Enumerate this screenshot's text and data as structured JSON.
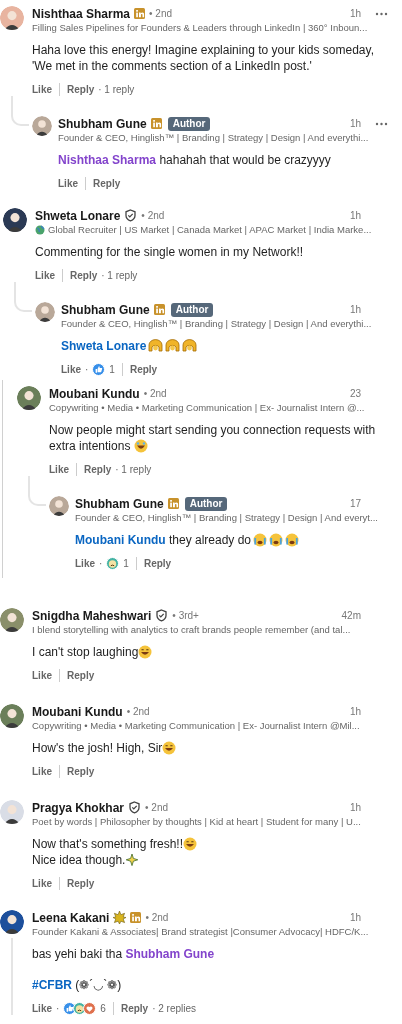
{
  "threads": [
    {
      "comment": {
        "name": "Nishthaa Sharma",
        "badges": [
          {
            "kind": "premium"
          }
        ],
        "degree": "• 2nd",
        "headline": "Filling Sales Pipelines for Founders & Leaders through LinkedIn | 360° Inboun...",
        "time": "1h",
        "more": true,
        "body": [
          {
            "segments": [
              {
                "kind": "text",
                "text": "Haha love this energy! Imagine explaining to your kids someday, 'We met in the comments section of a LinkedIn post.'"
              }
            ]
          }
        ],
        "like": "Like",
        "reply": "Reply",
        "reply_count": "· 1 reply"
      },
      "replies": [
        {
          "name": "Shubham Gune",
          "badges": [
            {
              "kind": "premium"
            }
          ],
          "tag": "Author",
          "headline": "Founder & CEO, Hinglish™ | Branding | Strategy | Design | And everythi...",
          "time": "1h",
          "more": true,
          "body": [
            {
              "segments": [
                {
                  "kind": "mention",
                  "text": "Nishthaa Sharma",
                  "visited": true
                },
                {
                  "kind": "text",
                  "text": " hahahah that would be crazyyyy"
                }
              ]
            }
          ],
          "like": "Like",
          "reply": "Reply"
        }
      ]
    },
    {
      "comment": {
        "name": "Shweta Lonare",
        "badges": [
          {
            "kind": "verified"
          }
        ],
        "degree": "• 2nd",
        "headline": "Global Recruiter | US Market | Canada Market | APAC Market | India Marke...",
        "globe": true,
        "time": "1h",
        "more": false,
        "body": [
          {
            "segments": [
              {
                "kind": "text",
                "text": "Commenting for the single women in my Network!!"
              }
            ]
          }
        ],
        "like": "Like",
        "reply": "Reply",
        "reply_count": "· 1 reply"
      },
      "replies": [
        {
          "name": "Shubham Gune",
          "badges": [
            {
              "kind": "premium"
            }
          ],
          "tag": "Author",
          "headline": "Founder & CEO, Hinglish™ | Branding | Strategy | Design | And everythi...",
          "time": "1h",
          "more": false,
          "body": [
            {
              "segments": [
                {
                  "kind": "mention",
                  "text": "Shweta Lonare",
                  "visited": false
                },
                {
                  "kind": "hands"
                },
                {
                  "kind": "hands"
                },
                {
                  "kind": "hands"
                }
              ]
            }
          ],
          "like": "Like",
          "reactions": {
            "separator": "·",
            "icons": [
              {
                "kind": "like"
              }
            ],
            "count": "1"
          },
          "reply": "Reply"
        }
      ]
    },
    {
      "comment": {
        "name": "Moubani Kundu",
        "degree": "• 2nd",
        "headline": "Copywriting • Media • Marketing Communication | Ex- Journalist Intern @...",
        "time": "23",
        "more": false,
        "body": [
          {
            "segments": [
              {
                "kind": "text",
                "text": "Now people might start sending you connection requests with extra intentions"
              },
              {
                "kind": "laugh"
              }
            ]
          }
        ],
        "like": "Like",
        "reply": "Reply",
        "reply_count": "· 1 reply"
      },
      "replies": [
        {
          "name": "Shubham Gune",
          "badges": [
            {
              "kind": "premium"
            }
          ],
          "tag": "Author",
          "headline": "Founder & CEO, Hinglish™ | Branding | Strategy | Design | And everyt...",
          "time": "17",
          "more": false,
          "body": [
            {
              "segments": [
                {
                  "kind": "mention",
                  "text": "Moubani Kundu",
                  "visited": false
                },
                {
                  "kind": "text",
                  "text": " they already do"
                },
                {
                  "kind": "cry"
                },
                {
                  "kind": "cry"
                },
                {
                  "kind": "cry"
                }
              ]
            }
          ],
          "like": "Like",
          "reactions": {
            "separator": "·",
            "icons": [
              {
                "kind": "sad"
              }
            ],
            "count": "1"
          },
          "reply": "Reply"
        }
      ]
    },
    {
      "comment": {
        "name": "Snigdha Maheshwari",
        "badges": [
          {
            "kind": "verified"
          }
        ],
        "degree": "• 3rd+",
        "headline": "I blend storytelling with analytics to craft brands people remember (and tal...",
        "time": "42m",
        "more": false,
        "body": [
          {
            "segments": [
              {
                "kind": "text",
                "text": "I can't stop laughing"
              },
              {
                "kind": "grin"
              }
            ]
          }
        ],
        "like": "Like",
        "reply": "Reply"
      }
    },
    {
      "comment": {
        "name": "Moubani Kundu",
        "degree": "• 2nd",
        "headline": "Copywriting • Media • Marketing Communication | Ex- Journalist Intern @Mil...",
        "time": "1h",
        "more": false,
        "body": [
          {
            "segments": [
              {
                "kind": "text",
                "text": "How's the josh! High, Sir"
              },
              {
                "kind": "grin"
              }
            ]
          }
        ],
        "like": "Like",
        "reply": "Reply"
      }
    },
    {
      "comment": {
        "name": "Pragya Khokhar",
        "badges": [
          {
            "kind": "verified"
          }
        ],
        "degree": "• 2nd",
        "headline": "Poet by words | Philosopher by thoughts | Kid at heart | Student for many | U...",
        "time": "1h",
        "more": false,
        "body": [
          {
            "segments": [
              {
                "kind": "text",
                "text": "Now that's something fresh!!"
              },
              {
                "kind": "grin"
              }
            ]
          },
          {
            "segments": [
              {
                "kind": "text",
                "text": "Nice idea though."
              },
              {
                "kind": "sparkle"
              }
            ]
          }
        ],
        "like": "Like",
        "reply": "Reply"
      }
    },
    {
      "comment": {
        "name": "Leena Kakani",
        "badges": [
          {
            "kind": "star"
          },
          {
            "kind": "premium"
          }
        ],
        "degree": "• 2nd",
        "headline": "Founder Kakani & Associates| Brand strategist |Consumer Advocacy| HDFC/K...",
        "time": "1h",
        "more": false,
        "body": [
          {
            "segments": [
              {
                "kind": "text",
                "text": "bas yehi baki tha "
              },
              {
                "kind": "mention",
                "text": "Shubham Gune",
                "visited": true
              }
            ]
          },
          {
            "gap_before": true,
            "segments": [
              {
                "kind": "hashtag",
                "text": "#CFBR"
              },
              {
                "kind": "text",
                "text": " (❁´◡`❁)"
              }
            ]
          }
        ],
        "like": "Like",
        "reactions": {
          "separator": "·",
          "icons": [
            {
              "kind": "like"
            },
            {
              "kind": "sad"
            },
            {
              "kind": "love"
            }
          ],
          "count": "6"
        },
        "reply": "Reply",
        "reply_count": "· 2 replies"
      }
    }
  ]
}
